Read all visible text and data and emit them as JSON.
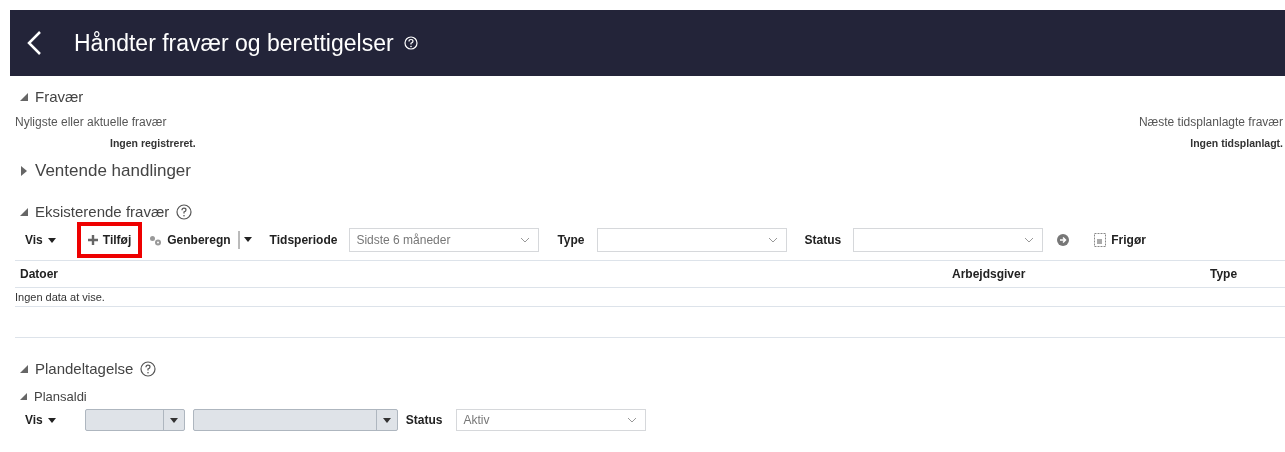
{
  "header": {
    "title": "Håndter fravær og berettigelser"
  },
  "absence_section": {
    "title": "Fravær",
    "expanded": true,
    "recent": {
      "label": "Nyligste eller aktuelle fravær",
      "value": "Ingen registreret."
    },
    "next": {
      "label": "Næste tidsplanlagte fravær",
      "value": "Ingen tidsplanlagt."
    }
  },
  "pending_section": {
    "title": "Ventende handlinger",
    "expanded": false
  },
  "existing_section": {
    "title": "Eksisterende fravær",
    "expanded": true,
    "toolbar": {
      "view_menu": "Vis",
      "add_button": {
        "label": "Tilføj",
        "highlighted": true
      },
      "recalc_button": "Genberegn",
      "filters": [
        {
          "label": "Tidsperiode",
          "value": "Sidste 6 måneder"
        },
        {
          "label": "Type"
        },
        {
          "label": "Status"
        }
      ],
      "release_button": "Frigør"
    },
    "table": {
      "columns": [
        "Datoer",
        "Arbejdsgiver",
        "Type"
      ],
      "empty_text": "Ingen data at vise."
    }
  },
  "plan_section": {
    "title": "Plandeltagelse",
    "expanded": true,
    "subsection": {
      "title": "Plansaldi",
      "expanded": true,
      "toolbar": {
        "view_menu": "Vis",
        "status_label": "Status",
        "status_value": "Aktiv"
      }
    }
  }
}
